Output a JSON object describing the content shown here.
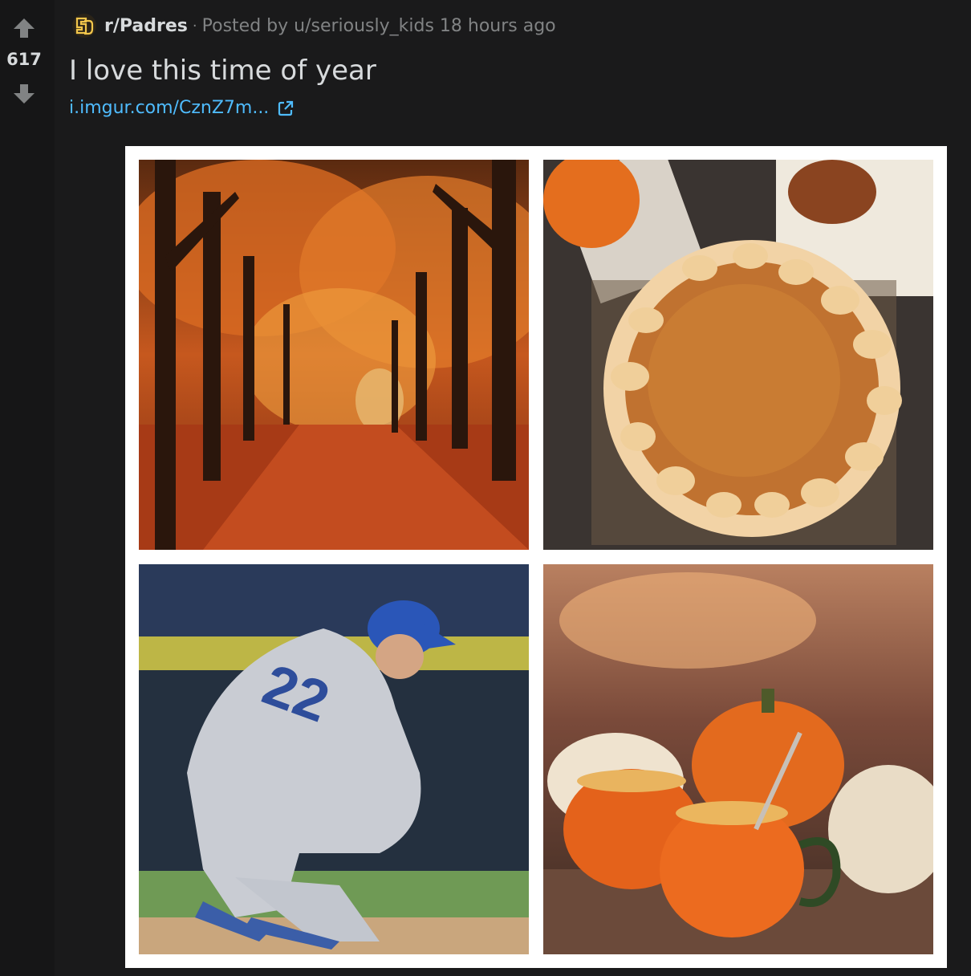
{
  "vote": {
    "count": "617",
    "upvote_icon": "arrow-up-icon",
    "downvote_icon": "arrow-down-icon"
  },
  "meta": {
    "subreddit": "r/Padres",
    "separator": "·",
    "posted_by": "Posted by u/seriously_kids 18 hours ago",
    "logo_icon": "padres-sd-logo-icon"
  },
  "post": {
    "title": "I love this time of year",
    "link_text": "i.imgur.com/CznZ7m...",
    "external_icon": "external-link-icon"
  },
  "colors": {
    "background": "#1a1a1b",
    "text": "#d7dadc",
    "muted": "#818384",
    "link": "#4fbcff",
    "padres_gold": "#f2c64b"
  }
}
